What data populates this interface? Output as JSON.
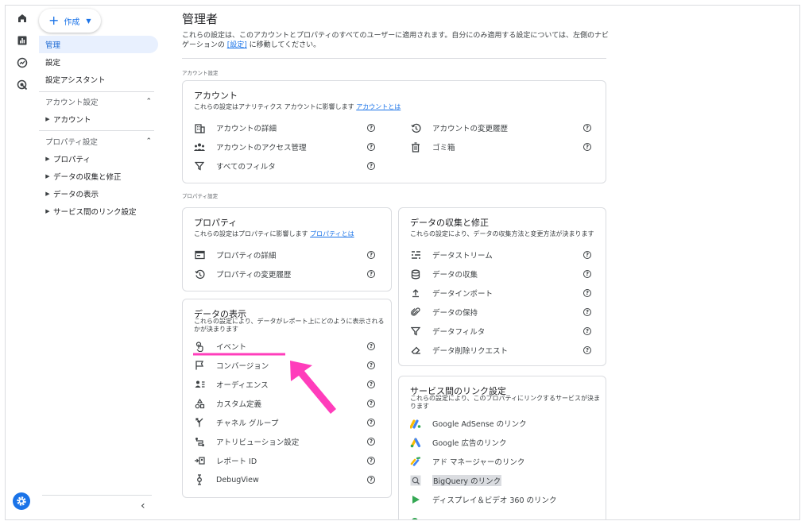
{
  "sidebar": {
    "create_label": "作成",
    "nav": [
      {
        "label": "管理",
        "active": true
      },
      {
        "label": "設定"
      },
      {
        "label": "設定アシスタント"
      }
    ],
    "sections": [
      {
        "label": "アカウント設定",
        "items": [
          "アカウント"
        ]
      },
      {
        "label": "プロパティ設定",
        "items": [
          "プロパティ",
          "データの収集と修正",
          "データの表示",
          "サービス間のリンク設定"
        ]
      }
    ]
  },
  "main": {
    "title": "管理者",
    "desc_part1": "これらの設定は、このアカウントとプロパティのすべてのユーザーに適用されます。自分にのみ適用する設定については、左側のナビゲー",
    "desc_part2": "ションの",
    "desc_link": "[設定]",
    "desc_part3": "に移動してください。",
    "account_section_label": "アカウント設定",
    "property_section_label": "プロパティ設定"
  },
  "account_card": {
    "title": "アカウント",
    "desc": "これらの設定はアナリティクス アカウントに影響します",
    "desc_link": "アカウントとは",
    "rows_left": [
      "アカウントの詳細",
      "アカウントのアクセス管理",
      "すべてのフィルタ"
    ],
    "rows_right": [
      "アカウントの変更履歴",
      "ゴミ箱"
    ]
  },
  "property_card": {
    "title": "プロパティ",
    "desc": "これらの設定はプロパティに影響します",
    "desc_link": "プロパティとは",
    "rows": [
      "プロパティの詳細",
      "プロパティの変更履歴"
    ]
  },
  "data_collection_card": {
    "title": "データの収集と修正",
    "desc": "これらの設定により、データの収集方法と変更方法が決まります",
    "rows": [
      "データストリーム",
      "データの収集",
      "データインポート",
      "データの保持",
      "データフィルタ",
      "データ削除リクエスト"
    ]
  },
  "data_display_card": {
    "title": "データの表示",
    "desc_line1": "これらの設定により、データがレポート上にどのように表示される",
    "desc_line2": "かが決まります",
    "rows": [
      "イベント",
      "コンバージョン",
      "オーディエンス",
      "カスタム定義",
      "チャネル グループ",
      "アトリビューション設定",
      "レポート ID",
      "DebugView"
    ]
  },
  "linking_card": {
    "title": "サービス間のリンク設定",
    "desc_line1": "これらの設定により、このプロパティにリンクするサービスが決ま",
    "desc_line2": "ります",
    "rows": [
      "Google AdSense のリンク",
      "Google 広告のリンク",
      "アド マネージャーのリンク",
      "BigQuery のリンク",
      "ディスプレイ＆ビデオ 360 のリンク"
    ]
  },
  "colors": {
    "accent": "#1a73e8",
    "annotation": "#ff3dbb",
    "active_nav_bg": "#e8f0fe"
  }
}
